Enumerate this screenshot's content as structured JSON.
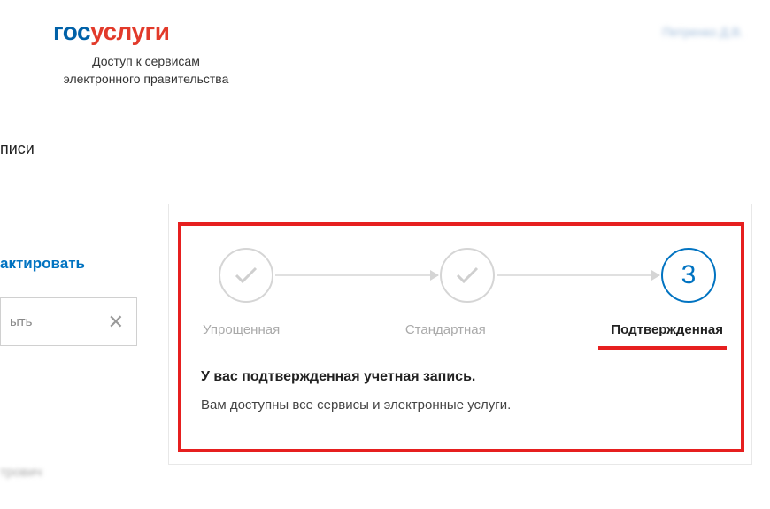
{
  "header": {
    "logo_part1": "гос",
    "logo_part2": "услуги",
    "tagline_line1": "Доступ к сервисам",
    "tagline_line2": "электронного правительства",
    "user_name": "Петренко Д.В."
  },
  "section_title": "писи",
  "left": {
    "edit_link": "актировать",
    "input_label": "ыть",
    "bottom_text": "трович"
  },
  "steps": {
    "step1_label": "Упрощенная",
    "step2_label": "Стандартная",
    "step3_label": "Подтвержденная",
    "step3_number": "3"
  },
  "status": {
    "title": "У вас подтвержденная учетная запись.",
    "description": "Вам доступны все сервисы и электронные услуги."
  }
}
